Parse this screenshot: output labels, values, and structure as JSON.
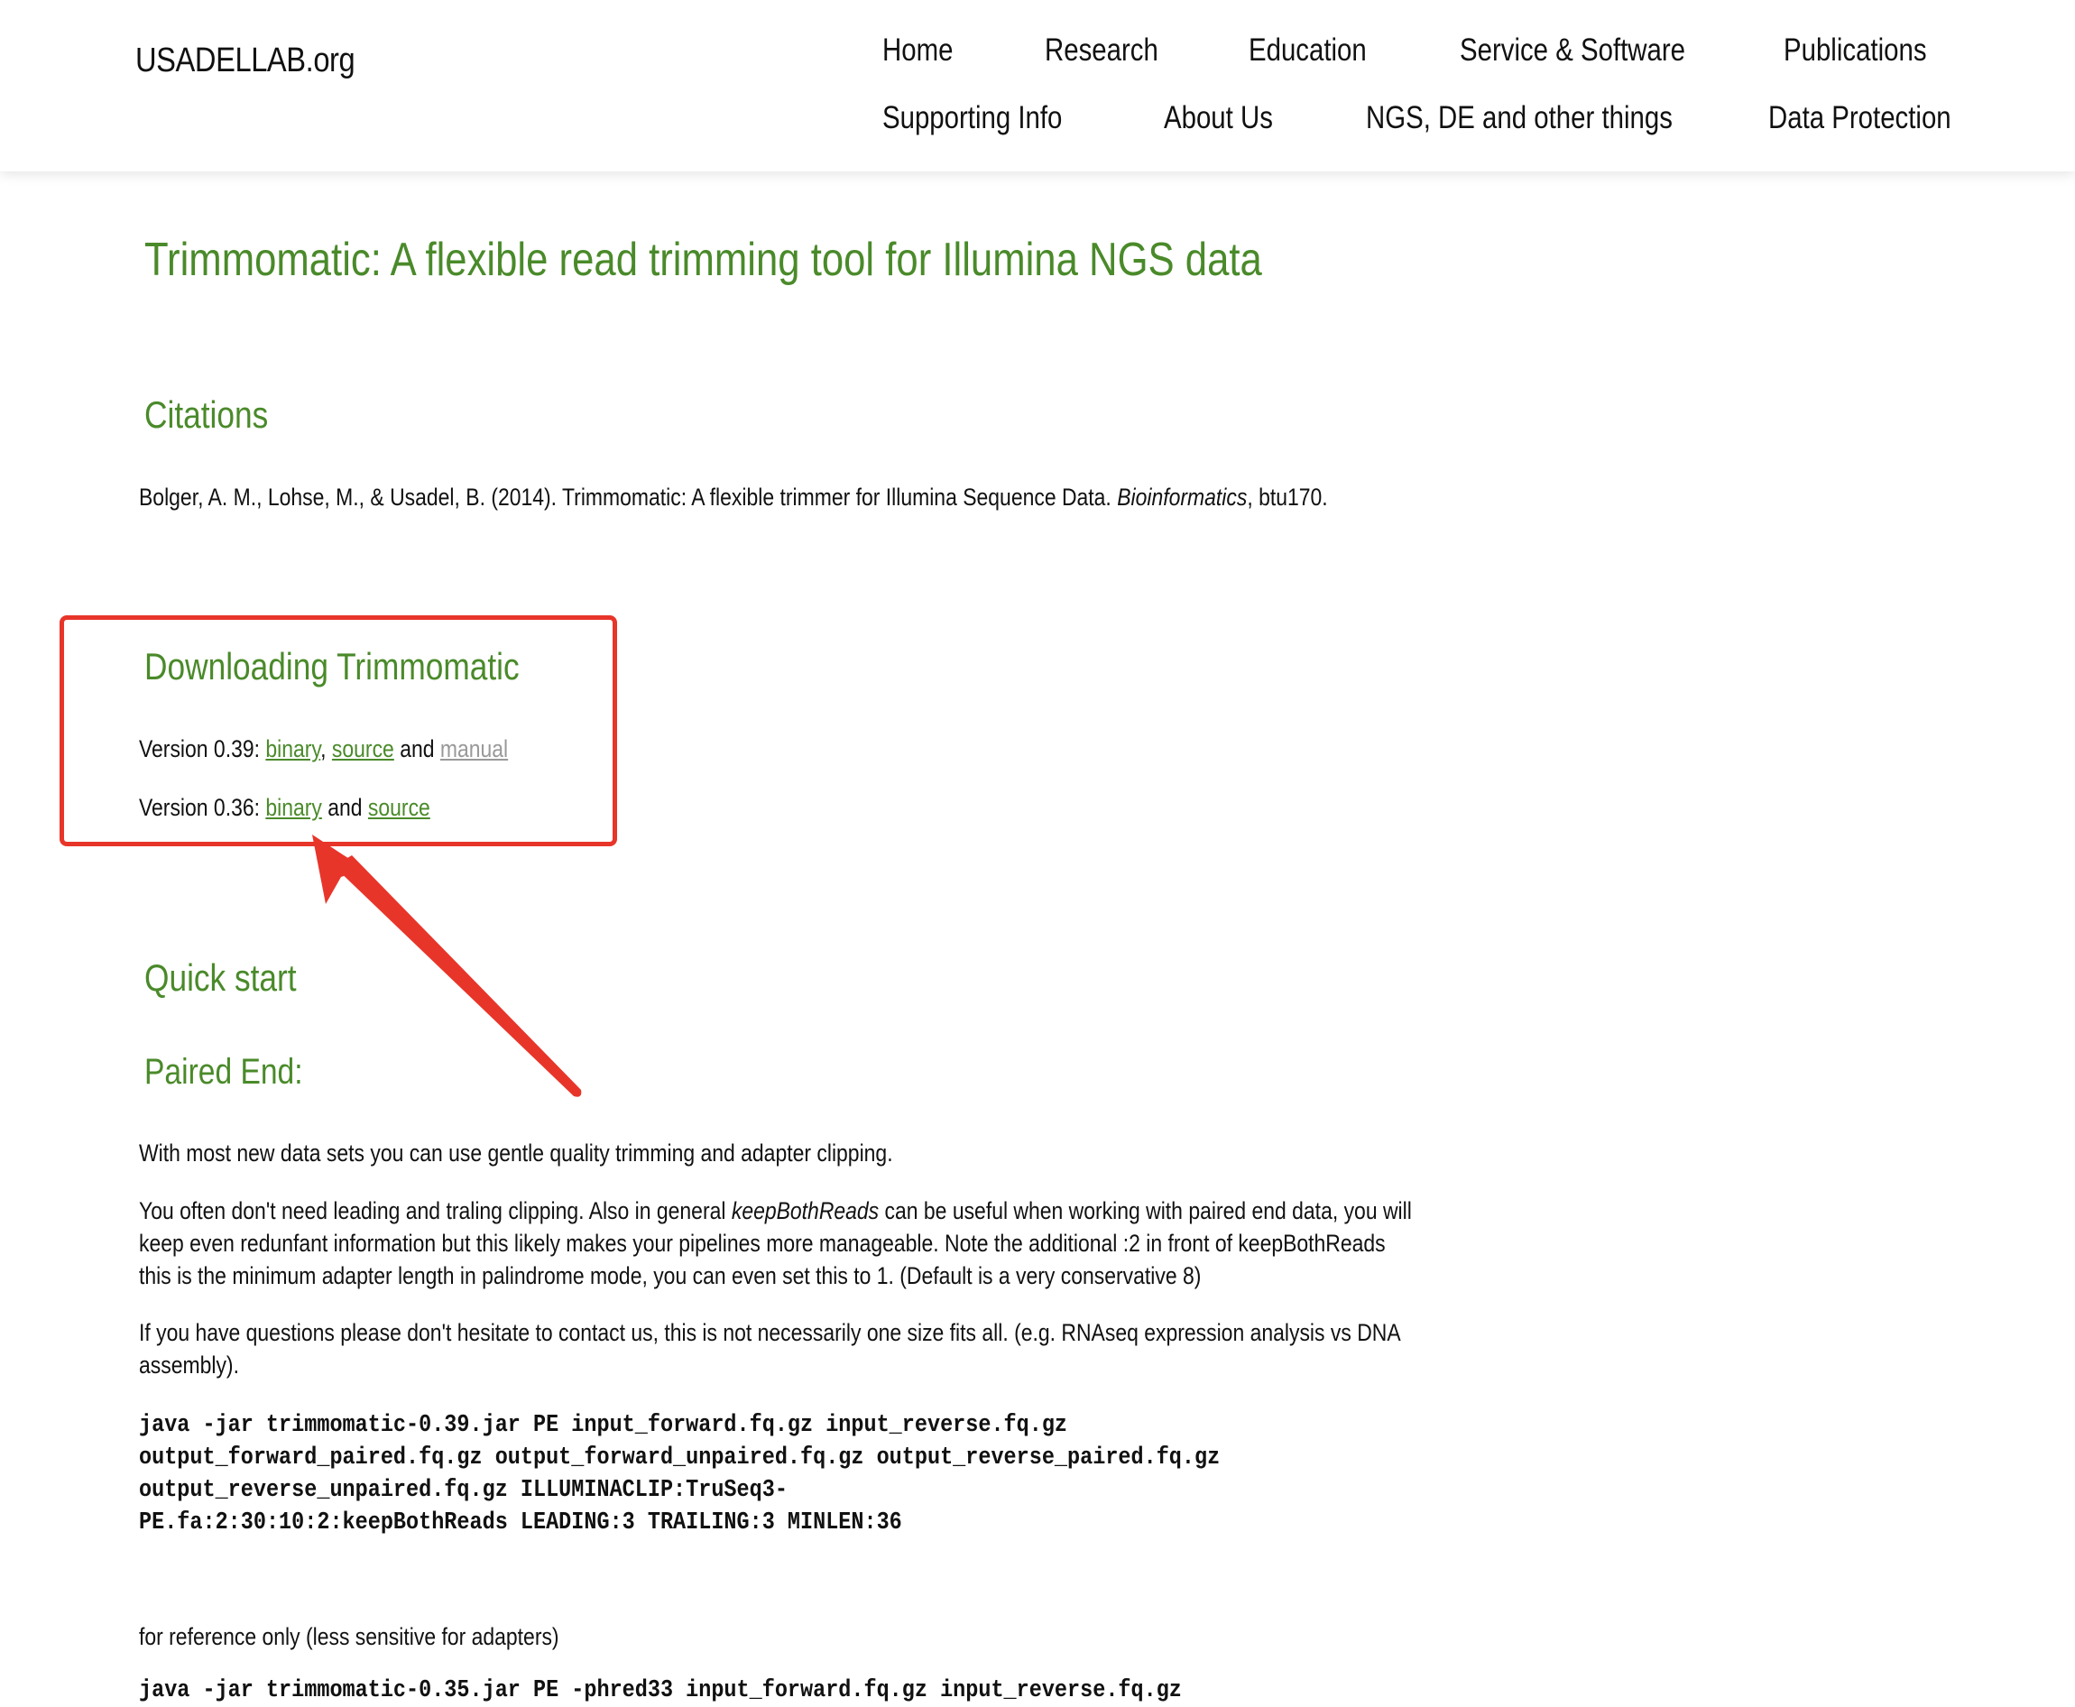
{
  "header": {
    "logo": "USADELLAB.org",
    "nav_row1": [
      "Home",
      "Research",
      "Education",
      "Service & Software",
      "Publications"
    ],
    "nav_row2": [
      "Supporting Info",
      "About Us",
      "NGS, DE and other things",
      "Data Protection"
    ]
  },
  "page": {
    "title": "Trimmomatic: A flexible read trimming tool for Illumina NGS data",
    "citations": {
      "heading": "Citations",
      "text_before": "Bolger, A. M., Lohse, M., & Usadel, B. (2014). Trimmomatic: A flexible trimmer for Illumina Sequence Data. ",
      "journal": "Bioinformatics",
      "text_after": ", btu170."
    },
    "downloading": {
      "heading": "Downloading Trimmomatic",
      "v039": {
        "label": "Version 0.39: ",
        "binary": "binary",
        "sep1": ", ",
        "source": "source",
        "sep2": " and ",
        "manual": "manual"
      },
      "v036": {
        "label": "Version 0.36: ",
        "binary": "binary",
        "sep": " and ",
        "source": "source"
      }
    },
    "quick_start": {
      "heading": "Quick start",
      "paired_end_heading": "Paired End:",
      "para1": "With most new data sets you can use gentle quality trimming and adapter clipping.",
      "para2_line1_before": "You often don't need leading and traling clipping. Also in general ",
      "para2_em": "keepBothReads",
      "para2_line1_after": " can be useful when working with paired end data, you will",
      "para2_line2": "keep even redunfant information but this likely makes your pipelines more manageable. Note the additional :2 in front of keepBothReads",
      "para2_line3": "this is the minimum adapter length in palindrome mode, you can even set this to 1. (Default is a very conservative 8)",
      "para3_line1": "If you have questions please don't hesitate to contact us, this is not necessarily one size fits all. (e.g. RNAseq expression analysis vs DNA",
      "para3_line2": "assembly).",
      "code_lines": [
        "java -jar trimmomatic-0.39.jar PE input_forward.fq.gz input_reverse.fq.gz",
        "output_forward_paired.fq.gz output_forward_unpaired.fq.gz output_reverse_paired.fq.gz",
        "output_reverse_unpaired.fq.gz ILLUMINACLIP:TruSeq3-",
        "PE.fa:2:30:10:2:keepBothReads LEADING:3 TRAILING:3 MINLEN:36"
      ],
      "reference_note": "for reference only (less sensitive for adapters)",
      "reference_code_partial": "java -jar trimmomatic-0.35.jar PE -phred33 input_forward.fq.gz input_reverse.fq.gz"
    }
  },
  "annotation": {
    "color": "#e8352a"
  },
  "colors": {
    "heading_green": "#4a8a2a",
    "link_green": "#4a8a2a",
    "muted_link": "#999999"
  }
}
